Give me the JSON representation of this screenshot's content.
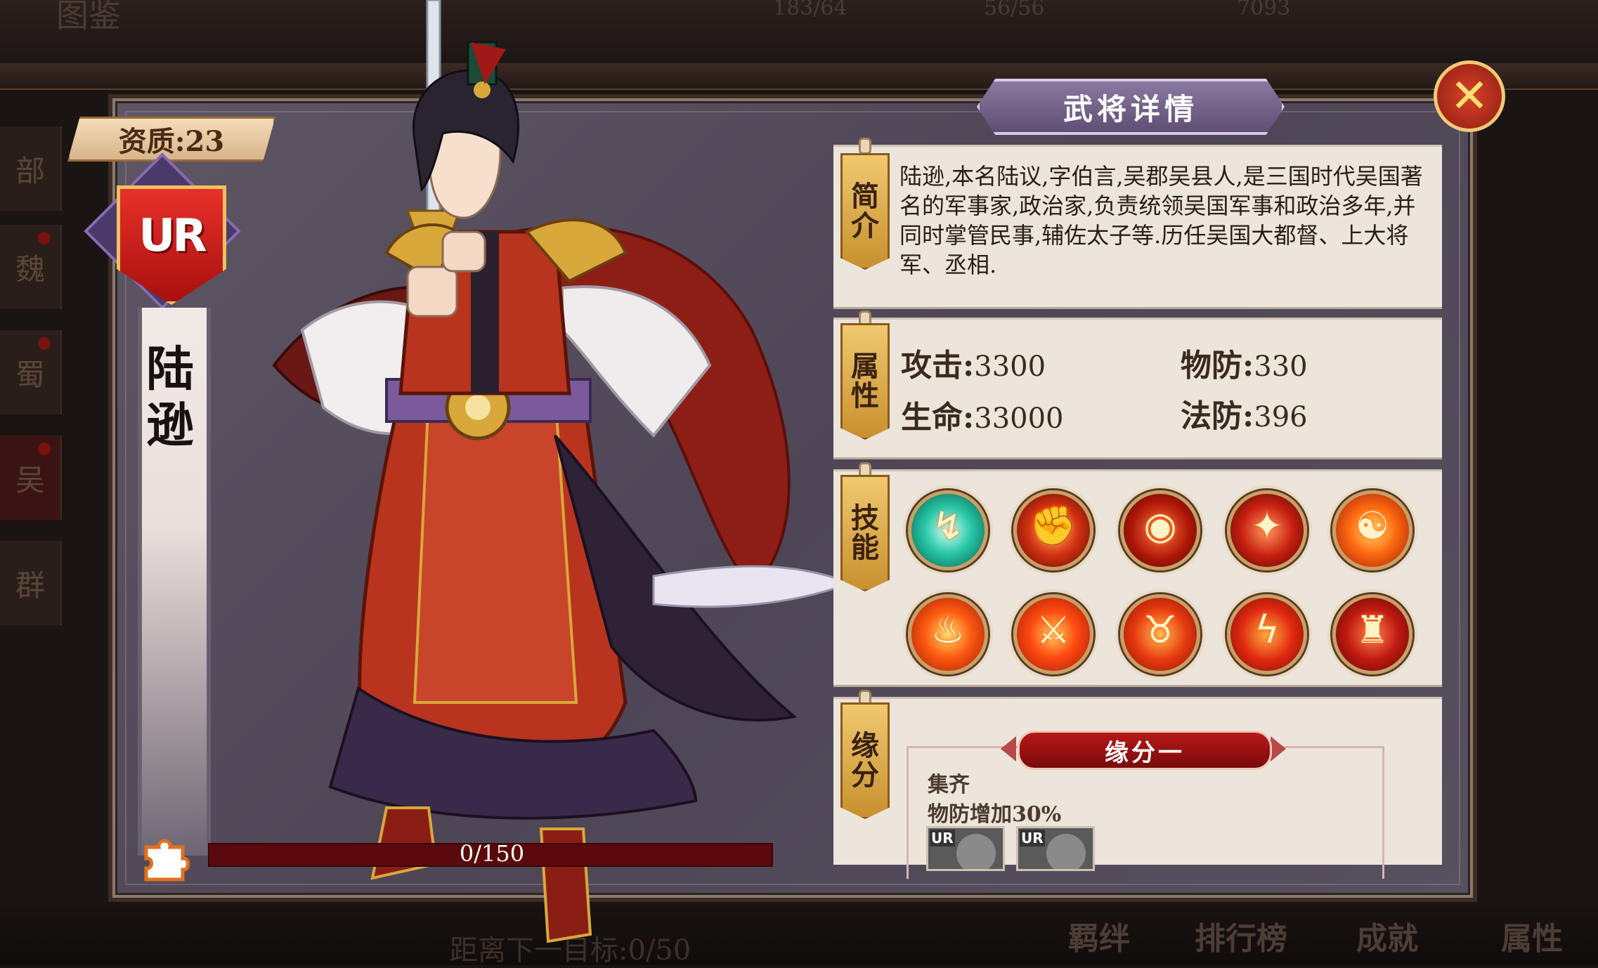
{
  "background": {
    "top_title": "图鉴",
    "top_stats": [
      "183/64",
      "56/56",
      "7093"
    ],
    "side_tabs": [
      "部",
      "魏",
      "蜀",
      "吴",
      "群"
    ],
    "bottom_nav": [
      "羁绊",
      "排行榜",
      "成就",
      "属性"
    ],
    "bottom_progress": "距离下一目标:0/50"
  },
  "hero": {
    "quality_label": "资质:23",
    "rarity": "UR",
    "name_chars": [
      "陆",
      "逊"
    ],
    "fragments": "0/150"
  },
  "panel": {
    "title": "武将详情",
    "close_icon": "✕"
  },
  "intro": {
    "tab": [
      "简",
      "介"
    ],
    "text": "陆逊,本名陆议,字伯言,吴郡吴县人,是三国时代吴国著名的军事家,政治家,负责统领吴国军事和政治多年,并同时掌管民事,辅佐太子等.历任吴国大都督、上大将军、丞相."
  },
  "attributes": {
    "tab": [
      "属",
      "性"
    ],
    "attack_label": "攻击:",
    "attack": "3300",
    "hp_label": "生命:",
    "hp": "33000",
    "pdef_label": "物防:",
    "pdef": "330",
    "mdef_label": "法防:",
    "mdef": "396"
  },
  "skills": {
    "tab": [
      "技",
      "能"
    ],
    "icons": [
      "wind-spiral-icon",
      "fire-fist-icon",
      "fire-vortex-icon",
      "fire-strike-icon",
      "fire-swirl-icon",
      "fire-spirit-icon",
      "flame-slash-icon",
      "fire-beast-icon",
      "flame-claw-icon",
      "flame-armor-icon"
    ]
  },
  "bond": {
    "tab": [
      "缘",
      "分"
    ],
    "banner": "缘分一",
    "line1": "集齐",
    "line2": "物防增加30%",
    "avatars": [
      "UR",
      "UR"
    ]
  },
  "colors": {
    "accent_gold": "#f0c870",
    "bond_red": "#b81818",
    "panel_purple": "#5e5664"
  }
}
